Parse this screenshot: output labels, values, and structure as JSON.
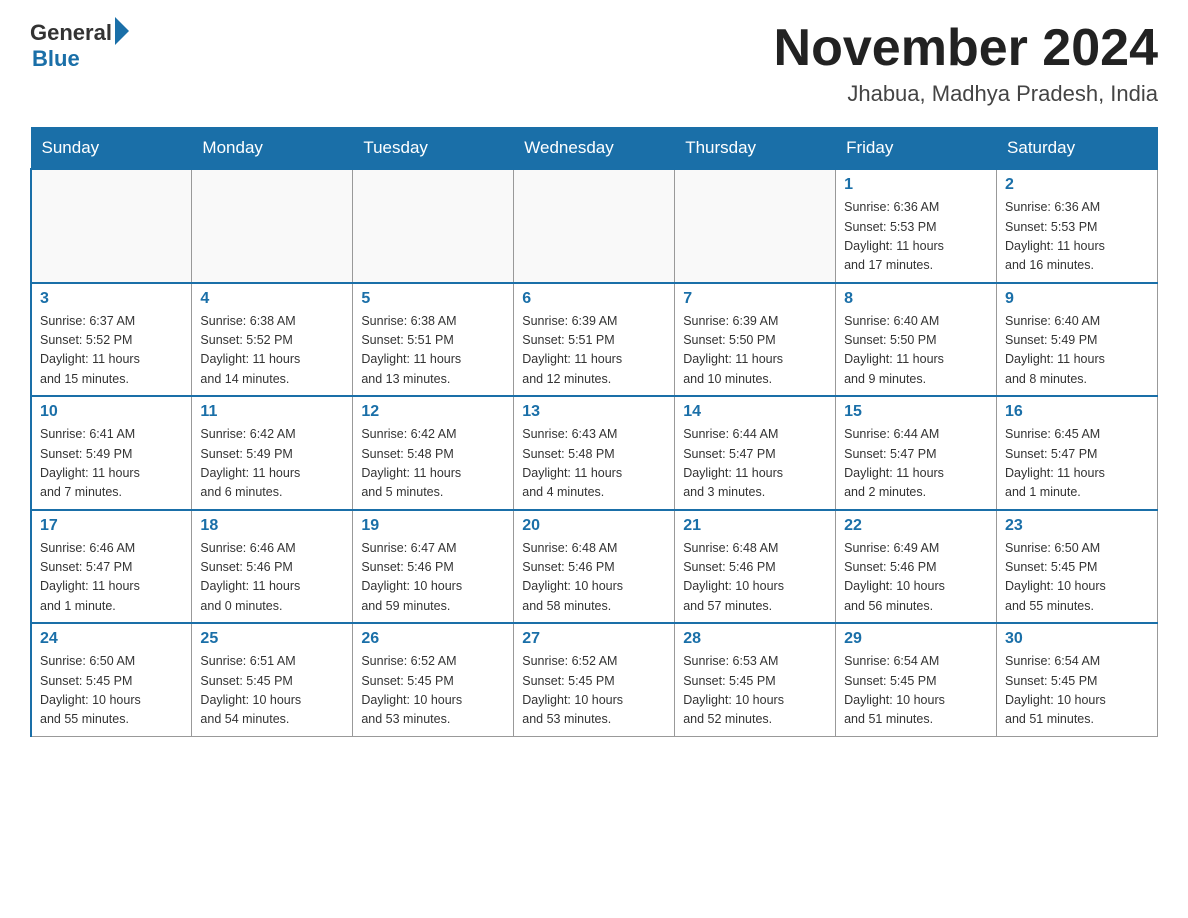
{
  "header": {
    "logo_general": "General",
    "logo_blue": "Blue",
    "title": "November 2024",
    "location": "Jhabua, Madhya Pradesh, India"
  },
  "days_of_week": [
    "Sunday",
    "Monday",
    "Tuesday",
    "Wednesday",
    "Thursday",
    "Friday",
    "Saturday"
  ],
  "weeks": [
    [
      {
        "day": "",
        "info": ""
      },
      {
        "day": "",
        "info": ""
      },
      {
        "day": "",
        "info": ""
      },
      {
        "day": "",
        "info": ""
      },
      {
        "day": "",
        "info": ""
      },
      {
        "day": "1",
        "info": "Sunrise: 6:36 AM\nSunset: 5:53 PM\nDaylight: 11 hours\nand 17 minutes."
      },
      {
        "day": "2",
        "info": "Sunrise: 6:36 AM\nSunset: 5:53 PM\nDaylight: 11 hours\nand 16 minutes."
      }
    ],
    [
      {
        "day": "3",
        "info": "Sunrise: 6:37 AM\nSunset: 5:52 PM\nDaylight: 11 hours\nand 15 minutes."
      },
      {
        "day": "4",
        "info": "Sunrise: 6:38 AM\nSunset: 5:52 PM\nDaylight: 11 hours\nand 14 minutes."
      },
      {
        "day": "5",
        "info": "Sunrise: 6:38 AM\nSunset: 5:51 PM\nDaylight: 11 hours\nand 13 minutes."
      },
      {
        "day": "6",
        "info": "Sunrise: 6:39 AM\nSunset: 5:51 PM\nDaylight: 11 hours\nand 12 minutes."
      },
      {
        "day": "7",
        "info": "Sunrise: 6:39 AM\nSunset: 5:50 PM\nDaylight: 11 hours\nand 10 minutes."
      },
      {
        "day": "8",
        "info": "Sunrise: 6:40 AM\nSunset: 5:50 PM\nDaylight: 11 hours\nand 9 minutes."
      },
      {
        "day": "9",
        "info": "Sunrise: 6:40 AM\nSunset: 5:49 PM\nDaylight: 11 hours\nand 8 minutes."
      }
    ],
    [
      {
        "day": "10",
        "info": "Sunrise: 6:41 AM\nSunset: 5:49 PM\nDaylight: 11 hours\nand 7 minutes."
      },
      {
        "day": "11",
        "info": "Sunrise: 6:42 AM\nSunset: 5:49 PM\nDaylight: 11 hours\nand 6 minutes."
      },
      {
        "day": "12",
        "info": "Sunrise: 6:42 AM\nSunset: 5:48 PM\nDaylight: 11 hours\nand 5 minutes."
      },
      {
        "day": "13",
        "info": "Sunrise: 6:43 AM\nSunset: 5:48 PM\nDaylight: 11 hours\nand 4 minutes."
      },
      {
        "day": "14",
        "info": "Sunrise: 6:44 AM\nSunset: 5:47 PM\nDaylight: 11 hours\nand 3 minutes."
      },
      {
        "day": "15",
        "info": "Sunrise: 6:44 AM\nSunset: 5:47 PM\nDaylight: 11 hours\nand 2 minutes."
      },
      {
        "day": "16",
        "info": "Sunrise: 6:45 AM\nSunset: 5:47 PM\nDaylight: 11 hours\nand 1 minute."
      }
    ],
    [
      {
        "day": "17",
        "info": "Sunrise: 6:46 AM\nSunset: 5:47 PM\nDaylight: 11 hours\nand 1 minute."
      },
      {
        "day": "18",
        "info": "Sunrise: 6:46 AM\nSunset: 5:46 PM\nDaylight: 11 hours\nand 0 minutes."
      },
      {
        "day": "19",
        "info": "Sunrise: 6:47 AM\nSunset: 5:46 PM\nDaylight: 10 hours\nand 59 minutes."
      },
      {
        "day": "20",
        "info": "Sunrise: 6:48 AM\nSunset: 5:46 PM\nDaylight: 10 hours\nand 58 minutes."
      },
      {
        "day": "21",
        "info": "Sunrise: 6:48 AM\nSunset: 5:46 PM\nDaylight: 10 hours\nand 57 minutes."
      },
      {
        "day": "22",
        "info": "Sunrise: 6:49 AM\nSunset: 5:46 PM\nDaylight: 10 hours\nand 56 minutes."
      },
      {
        "day": "23",
        "info": "Sunrise: 6:50 AM\nSunset: 5:45 PM\nDaylight: 10 hours\nand 55 minutes."
      }
    ],
    [
      {
        "day": "24",
        "info": "Sunrise: 6:50 AM\nSunset: 5:45 PM\nDaylight: 10 hours\nand 55 minutes."
      },
      {
        "day": "25",
        "info": "Sunrise: 6:51 AM\nSunset: 5:45 PM\nDaylight: 10 hours\nand 54 minutes."
      },
      {
        "day": "26",
        "info": "Sunrise: 6:52 AM\nSunset: 5:45 PM\nDaylight: 10 hours\nand 53 minutes."
      },
      {
        "day": "27",
        "info": "Sunrise: 6:52 AM\nSunset: 5:45 PM\nDaylight: 10 hours\nand 53 minutes."
      },
      {
        "day": "28",
        "info": "Sunrise: 6:53 AM\nSunset: 5:45 PM\nDaylight: 10 hours\nand 52 minutes."
      },
      {
        "day": "29",
        "info": "Sunrise: 6:54 AM\nSunset: 5:45 PM\nDaylight: 10 hours\nand 51 minutes."
      },
      {
        "day": "30",
        "info": "Sunrise: 6:54 AM\nSunset: 5:45 PM\nDaylight: 10 hours\nand 51 minutes."
      }
    ]
  ]
}
